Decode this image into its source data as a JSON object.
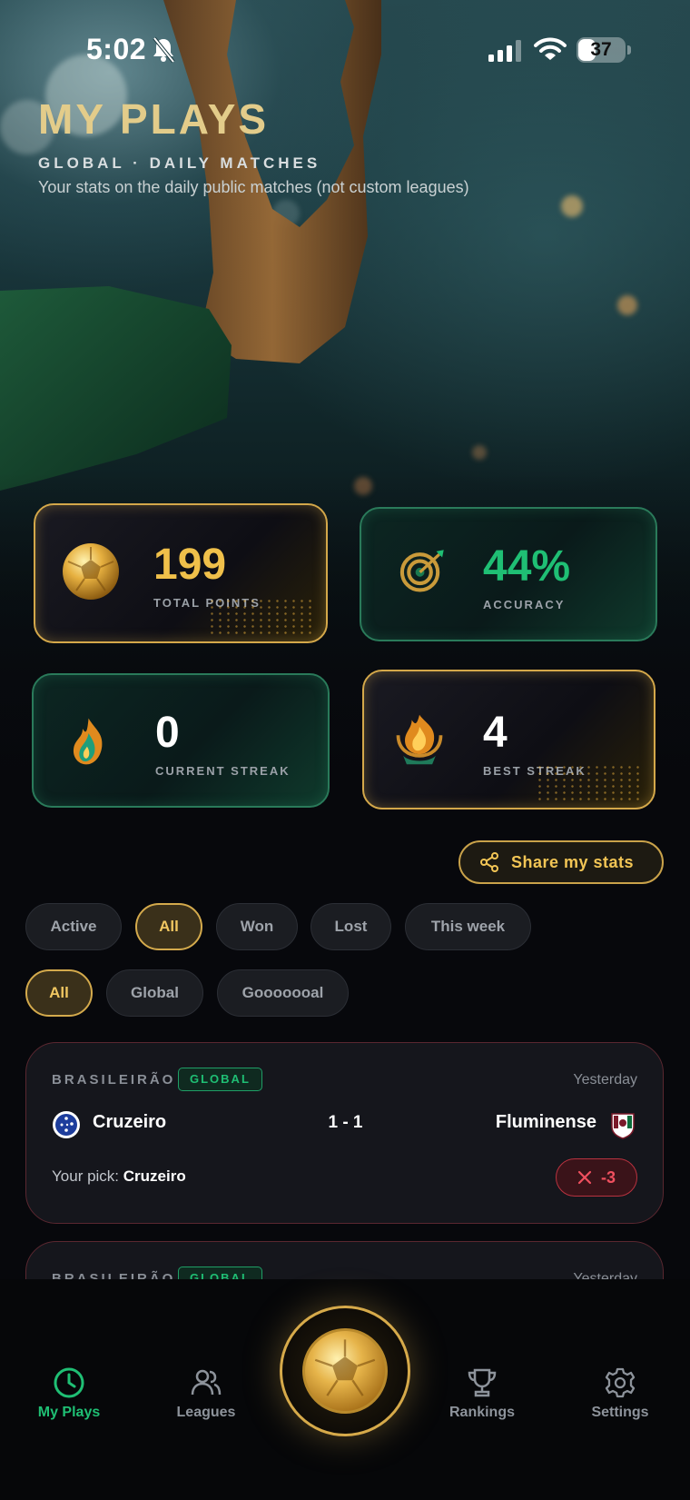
{
  "status_bar": {
    "time": "5:02",
    "battery": "37",
    "battery_level": 0.37
  },
  "header": {
    "title": "MY PLAYS",
    "subtitle": "GLOBAL · DAILY MATCHES",
    "description": "Your stats on the daily public matches (not custom leagues)"
  },
  "stats": [
    {
      "value": "199",
      "label": "TOTAL POINTS",
      "icon": "gold-ball-icon",
      "style": "gold"
    },
    {
      "value": "44%",
      "label": "ACCURACY",
      "icon": "target-icon",
      "style": "green"
    },
    {
      "value": "0",
      "label": "CURRENT STREAK",
      "icon": "flame-icon",
      "style": "green"
    },
    {
      "value": "4",
      "label": "BEST STREAK",
      "icon": "flame-trophy-icon",
      "style": "gold"
    }
  ],
  "share_button": {
    "label": "Share my stats"
  },
  "filters": {
    "status": [
      "Active",
      "All",
      "Won",
      "Lost",
      "This week"
    ],
    "status_selected": "All",
    "scope": [
      "All",
      "Global",
      "Gooooooal"
    ],
    "scope_selected": "All"
  },
  "matches": [
    {
      "league": "BRASILEIRÃO",
      "badge": "GLOBAL",
      "date": "Yesterday",
      "home_team": "Cruzeiro",
      "away_team": "Fluminense",
      "score": "1 - 1",
      "pick_prefix": "Your pick:",
      "pick": "Cruzeiro",
      "result": "-3"
    },
    {
      "league": "BRASILEIRÃO",
      "badge": "GLOBAL",
      "date": "Yesterday"
    }
  ],
  "nav": {
    "items": [
      "My Plays",
      "Leagues",
      "Rankings",
      "Settings"
    ],
    "active": "My Plays"
  },
  "colors": {
    "gold": "#f0c04a",
    "green": "#1fbf74",
    "red": "#f0505f",
    "background": "#07080c"
  }
}
